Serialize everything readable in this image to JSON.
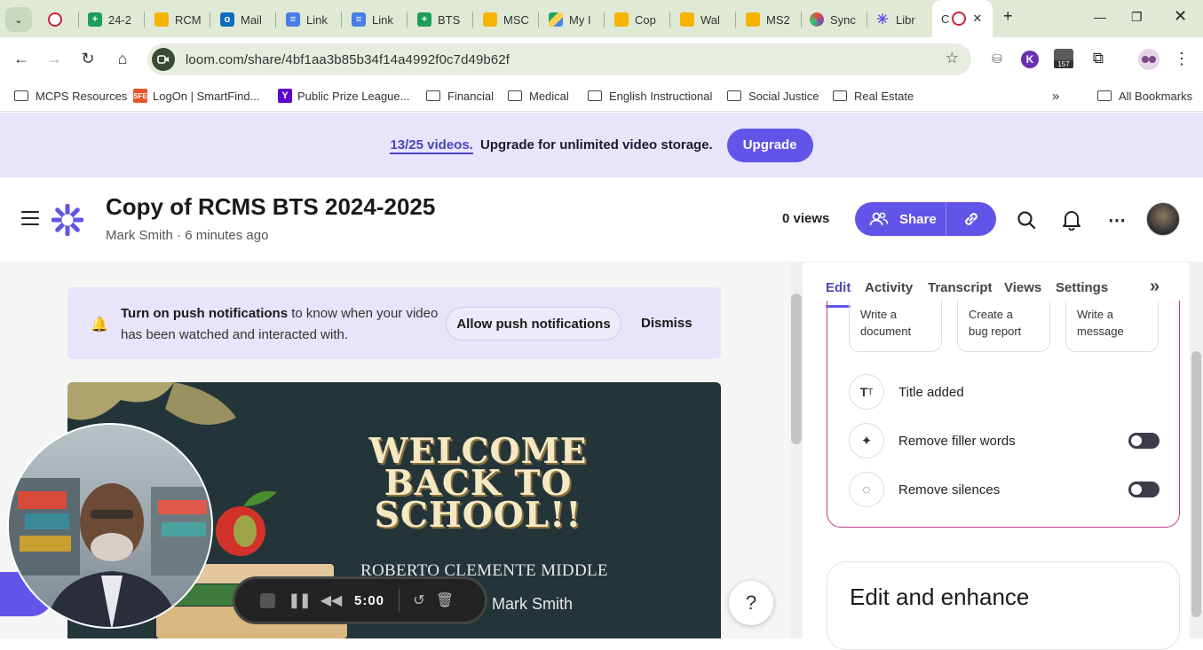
{
  "browser": {
    "tabs": [
      {
        "label": "",
        "icon": "loom-record-icon"
      },
      {
        "label": "24-2",
        "icon": "sheets-icon"
      },
      {
        "label": "RCM",
        "icon": "slides-icon"
      },
      {
        "label": "Mail",
        "icon": "outlook-icon"
      },
      {
        "label": "Link",
        "icon": "docs-icon"
      },
      {
        "label": "Link",
        "icon": "docs-icon"
      },
      {
        "label": "BTS",
        "icon": "sheets-icon"
      },
      {
        "label": "MSC",
        "icon": "slides-icon"
      },
      {
        "label": "My I",
        "icon": "drive-icon"
      },
      {
        "label": "Cop",
        "icon": "slides-icon"
      },
      {
        "label": "Wal",
        "icon": "slides-icon"
      },
      {
        "label": "MS2",
        "icon": "slides-icon"
      },
      {
        "label": "Sync",
        "icon": "sync-icon"
      },
      {
        "label": "Libr",
        "icon": "loom-icon"
      },
      {
        "label": "C",
        "icon": "loom-record-icon"
      }
    ],
    "url": "loom.com/share/4bf1aa3b85b34f14a4992f0c7d49b62f",
    "extension_badge": "157",
    "bookmarks": [
      {
        "label": "MCPS Resources"
      },
      {
        "label": "LogOn | SmartFind..."
      },
      {
        "label": "Public Prize League..."
      },
      {
        "label": "Financial"
      },
      {
        "label": "Medical"
      },
      {
        "label": "English Instructional"
      },
      {
        "label": "Social Justice"
      },
      {
        "label": "Real Estate"
      }
    ],
    "all_bookmarks": "All Bookmarks"
  },
  "banner": {
    "count": "13/25 videos.",
    "text": "Upgrade for unlimited video storage.",
    "button": "Upgrade"
  },
  "header": {
    "title": "Copy of RCMS BTS 2024-2025",
    "author": "Mark Smith",
    "time": "6 minutes ago",
    "views": "0 views",
    "share": "Share"
  },
  "notification": {
    "bold": "Turn on push notifications",
    "text": " to know when your video has been watched and interacted with.",
    "allow": "Allow push notifications",
    "dismiss": "Dismiss"
  },
  "video": {
    "headline": "WELCOME BACK TO SCHOOL!!",
    "school": "ROBERTO CLEMENTE MIDDLE SCHOOL",
    "presenter": "Mark Smith"
  },
  "recording": {
    "time": "5:00"
  },
  "sidebar": {
    "tabs": [
      "Edit",
      "Activity",
      "Transcript",
      "Views",
      "Settings"
    ],
    "chips": [
      {
        "line1": "Write a",
        "line2": "document"
      },
      {
        "line1": "Create a",
        "line2": "bug report"
      },
      {
        "line1": "Write a",
        "line2": "message"
      }
    ],
    "rows": [
      {
        "label": "Title added"
      },
      {
        "label": "Remove filler words"
      },
      {
        "label": "Remove silences"
      }
    ],
    "enhance_title": "Edit and enhance"
  },
  "colors": {
    "accent": "#6254e8",
    "banner_bg": "#e7e4fb",
    "tabbar_bg": "#dfe9d4",
    "video_bg": "#233538"
  }
}
